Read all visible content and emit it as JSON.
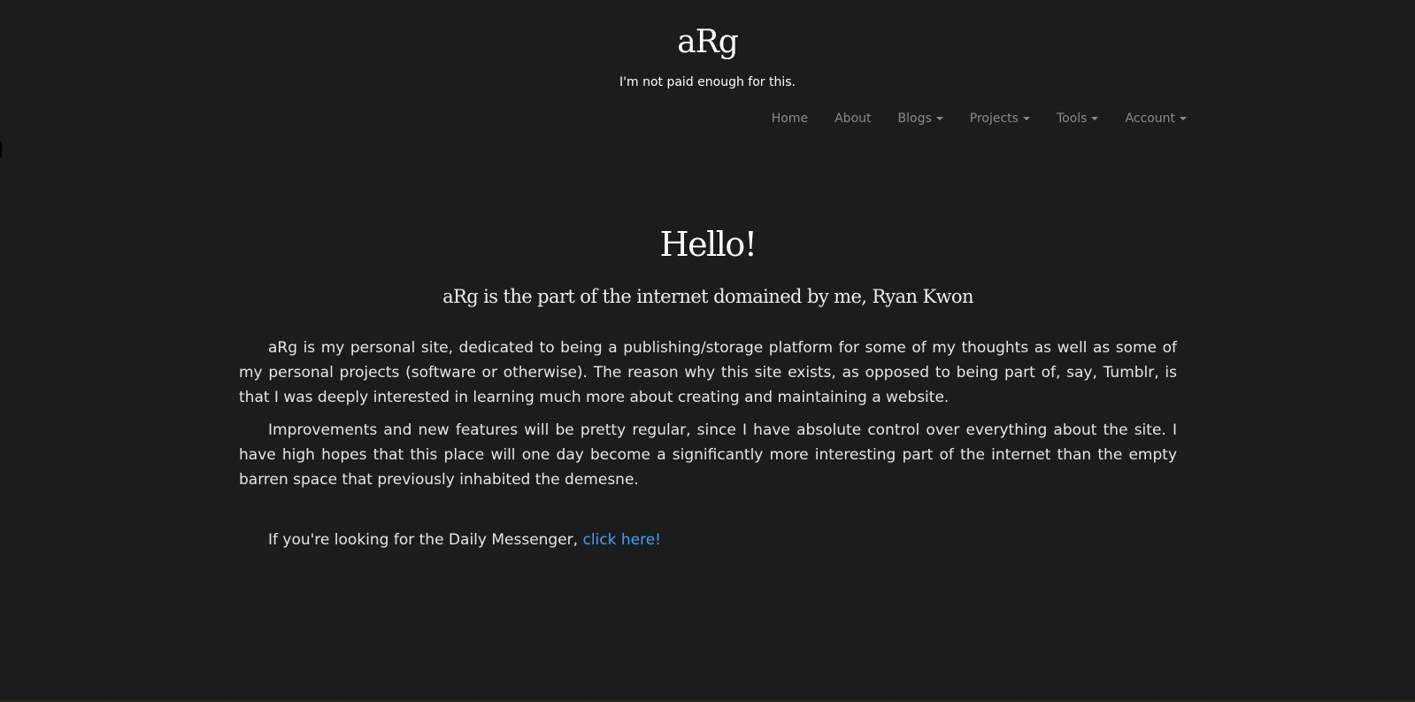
{
  "header": {
    "site_title": "aRg",
    "tagline": "I'm not paid enough for this."
  },
  "nav": {
    "items": [
      {
        "label": "Home",
        "dropdown": false
      },
      {
        "label": "About",
        "dropdown": false
      },
      {
        "label": "Blogs",
        "dropdown": true
      },
      {
        "label": "Projects",
        "dropdown": true
      },
      {
        "label": "Tools",
        "dropdown": true
      },
      {
        "label": "Account",
        "dropdown": true
      }
    ]
  },
  "main": {
    "title": "Hello!",
    "subtitle": "aRg is the part of the internet domained by me, Ryan Kwon",
    "paragraphs": [
      "aRg is my personal site, dedicated to being a publishing/storage platform for some of my thoughts as well as some of my personal projects (software or otherwise). The reason why this site exists, as opposed to being part of, say, Tumblr, is that I was deeply interested in learning much more about creating and maintaining a website.",
      "Improvements and new features will be pretty regular, since I have absolute control over everything about the site. I have high hopes that this place will one day become a significantly more interesting part of the internet than the empty barren space that previously inhabited the demesne."
    ],
    "daily_prefix": "If you're looking for the Daily Messenger, ",
    "daily_link": "click here!"
  },
  "colors": {
    "background": "#1c1c1c",
    "nav_text": "#8a8a8a",
    "link": "#3ea2ff",
    "text": "#e6e6e6"
  }
}
